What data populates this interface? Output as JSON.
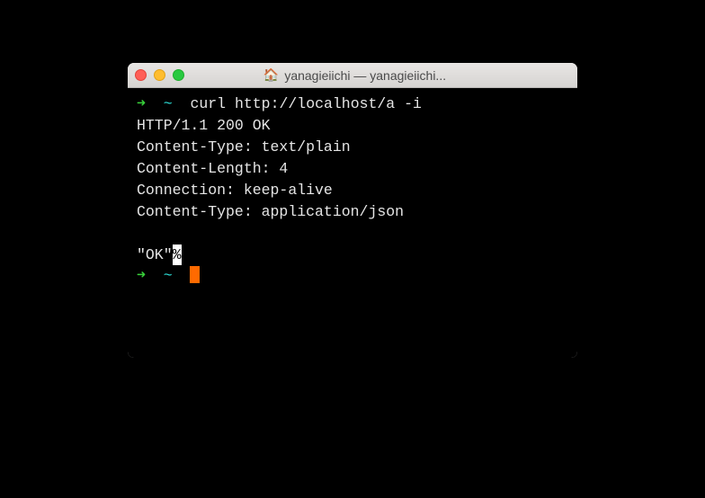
{
  "titlebar": {
    "icon": "🏠",
    "title": "yanagieiichi — yanagieiichi..."
  },
  "terminal": {
    "prompt_arrow": "➜",
    "prompt_tilde": "~",
    "command": "curl http://localhost/a -i",
    "response": {
      "status": "HTTP/1.1 200 OK",
      "h1": "Content-Type: text/plain",
      "h2": "Content-Length: 4",
      "h3": "Connection: keep-alive",
      "h4": "Content-Type: application/json"
    },
    "body_text": "\"OK\"",
    "percent": "%"
  }
}
